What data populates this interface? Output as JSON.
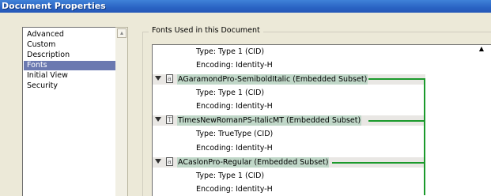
{
  "window": {
    "title": "Document Properties"
  },
  "categories": [
    {
      "label": "Advanced",
      "selected": false
    },
    {
      "label": "Custom",
      "selected": false
    },
    {
      "label": "Description",
      "selected": false
    },
    {
      "label": "Fonts",
      "selected": true
    },
    {
      "label": "Initial View",
      "selected": false
    },
    {
      "label": "Security",
      "selected": false
    }
  ],
  "fonts_group": {
    "label": "Fonts Used in this Document"
  },
  "tree": {
    "rows": [
      {
        "kind": "detail",
        "text": "Type: Type 1 (CID)"
      },
      {
        "kind": "detail",
        "text": "Encoding: Identity-H"
      },
      {
        "kind": "font",
        "name": "AGaramondPro-SemiboldItalic (Embedded Subset)",
        "icon": "type1-font-icon",
        "expanded": true
      },
      {
        "kind": "detail",
        "text": "Type: Type 1 (CID)"
      },
      {
        "kind": "detail",
        "text": "Encoding: Identity-H"
      },
      {
        "kind": "font",
        "name": "TimesNewRomanPS-ItalicMT (Embedded Subset)",
        "icon": "truetype-font-icon",
        "expanded": true
      },
      {
        "kind": "detail",
        "text": "Type: TrueType (CID)"
      },
      {
        "kind": "detail",
        "text": "Encoding: Identity-H"
      },
      {
        "kind": "font",
        "name": "ACaslonPro-Regular (Embedded Subset)",
        "icon": "type1-font-icon",
        "expanded": true
      },
      {
        "kind": "detail",
        "text": "Type: Type 1 (CID)"
      },
      {
        "kind": "detail",
        "text": "Encoding: Identity-H"
      }
    ]
  },
  "colors": {
    "titlebar": "#2a63c3",
    "selection": "#6b79b0",
    "highlight": "#c0d7c8",
    "connector": "#1b9a2c"
  }
}
